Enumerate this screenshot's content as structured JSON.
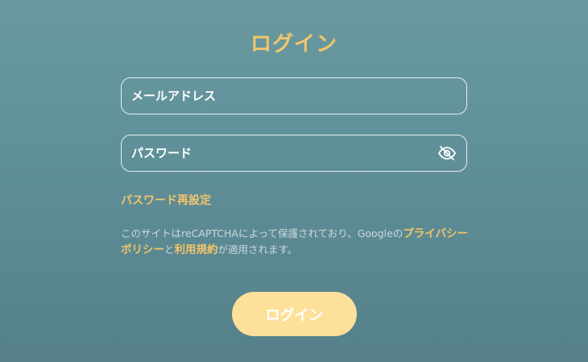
{
  "title": "ログイン",
  "email_field": {
    "placeholder": "メールアドレス",
    "value": ""
  },
  "password_field": {
    "placeholder": "パスワード",
    "value": "",
    "toggle_icon": "eye-slash-icon"
  },
  "reset_link": "パスワード再設定",
  "recaptcha_notice": {
    "prefix": "このサイトはreCAPTCHAによって保護されており、Googleの",
    "privacy_link": "プライバシーポリシー",
    "middle": "と",
    "terms_link": "利用規約",
    "suffix": "が適用されます。"
  },
  "login_button": "ログイン",
  "colors": {
    "accent": "#f3c56a",
    "button_bg": "#fde09a",
    "background_top": "#6a9aa0",
    "background_bottom": "#55808a",
    "field_border": "#e8eef0"
  }
}
